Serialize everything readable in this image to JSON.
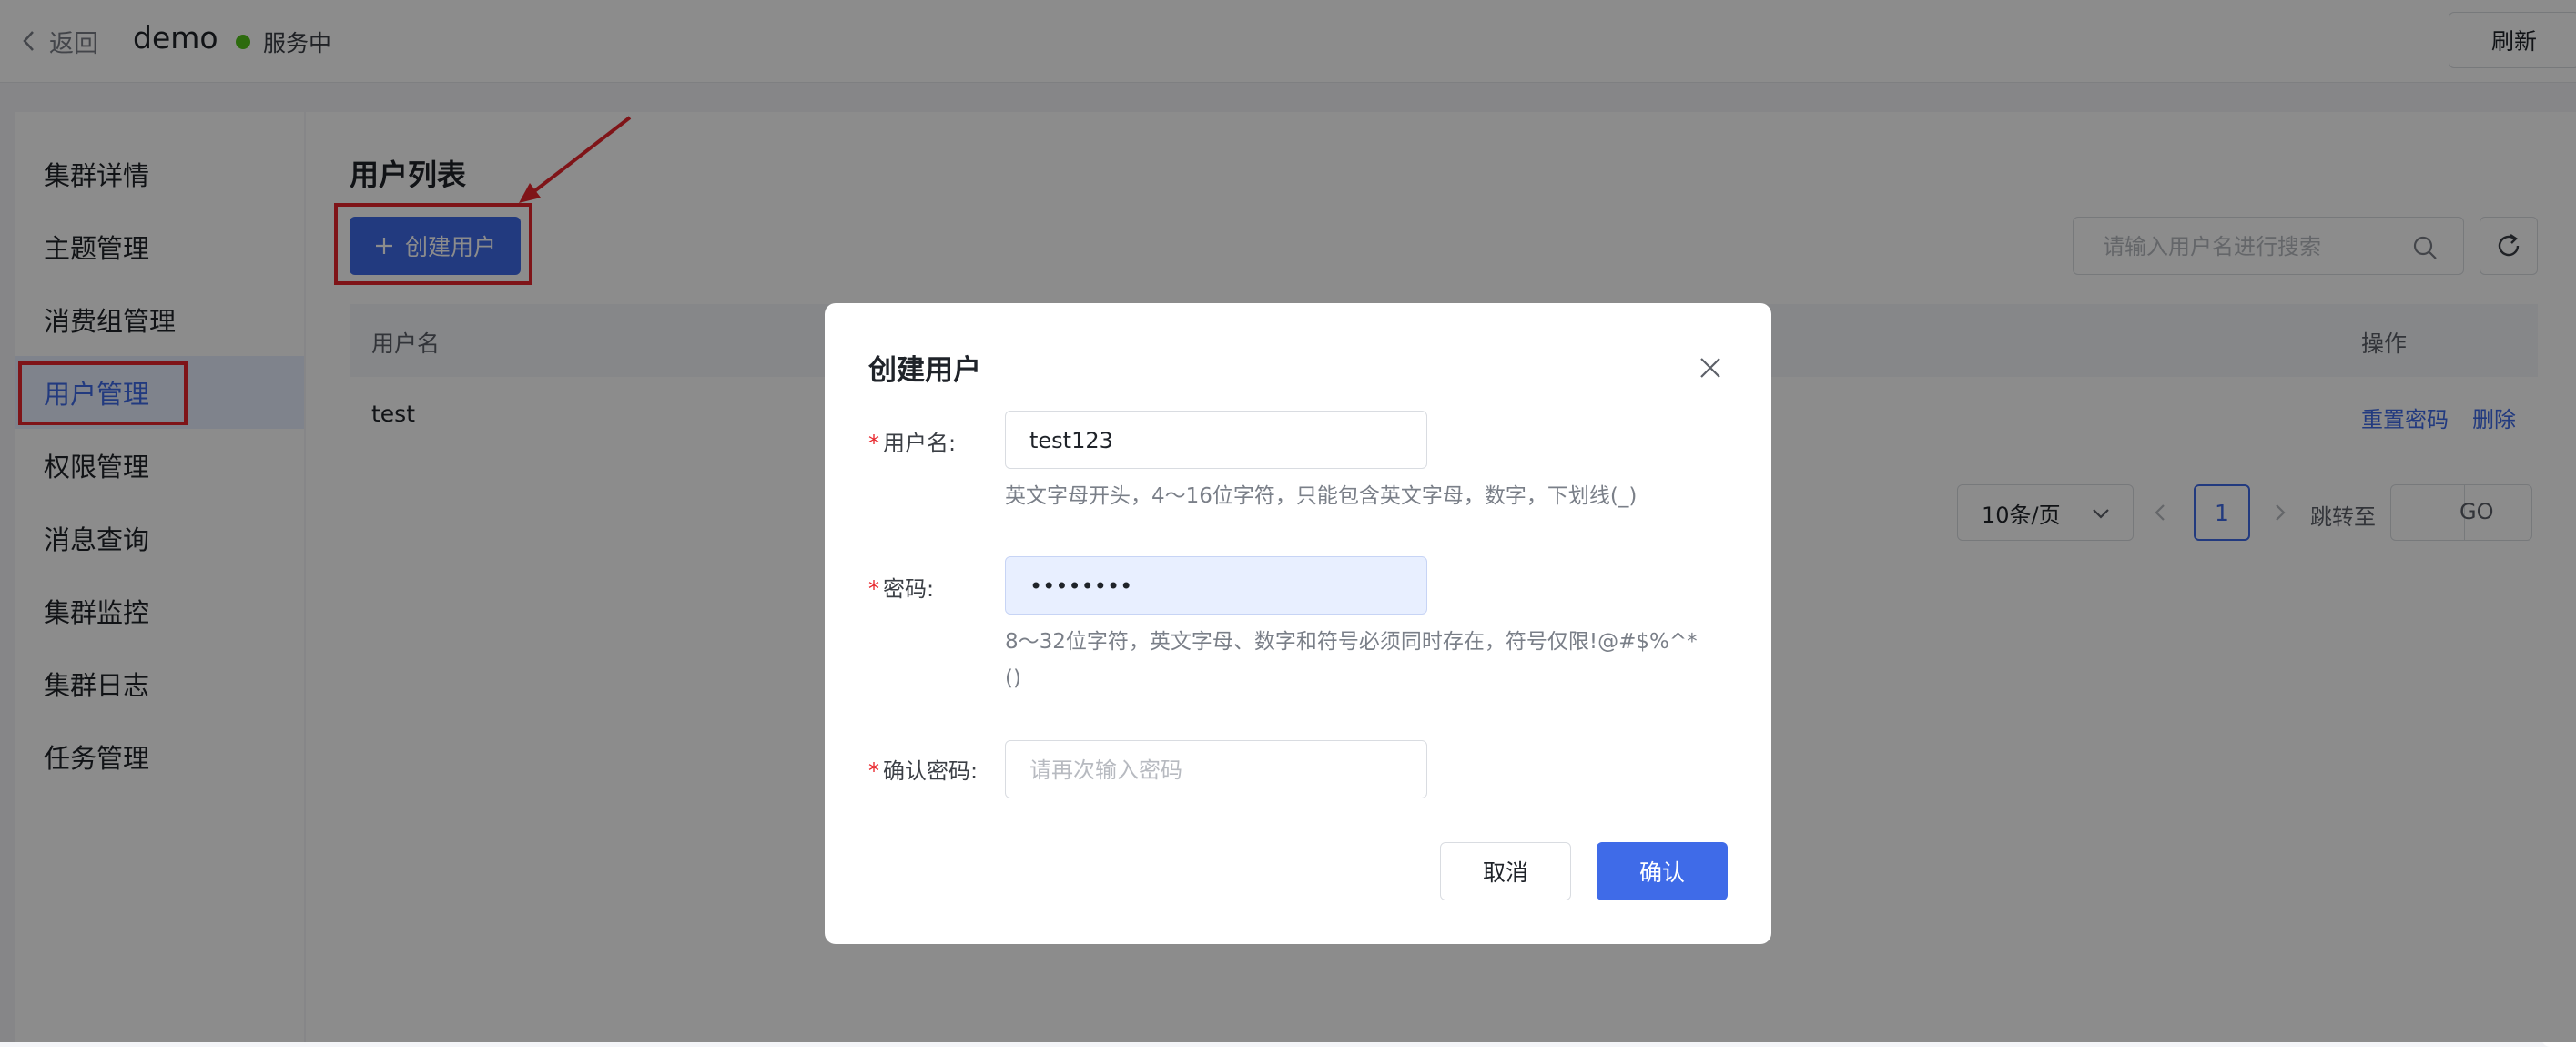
{
  "header": {
    "back_label": "返回",
    "app_name": "demo",
    "status_text": "服务中",
    "refresh_label": "刷新"
  },
  "sidebar": {
    "items": [
      {
        "label": "集群详情"
      },
      {
        "label": "主题管理"
      },
      {
        "label": "消费组管理"
      },
      {
        "label": "用户管理",
        "active": true
      },
      {
        "label": "权限管理"
      },
      {
        "label": "消息查询"
      },
      {
        "label": "集群监控"
      },
      {
        "label": "集群日志"
      },
      {
        "label": "任务管理"
      }
    ]
  },
  "main": {
    "title": "用户列表",
    "create_button": "创建用户",
    "search_placeholder": "请输入用户名进行搜索",
    "table": {
      "columns": [
        "用户名",
        "操作"
      ],
      "rows": [
        {
          "username": "test",
          "actions": [
            "重置密码",
            "删除"
          ]
        }
      ]
    },
    "pagination": {
      "page_size": "10条/页",
      "current_page": "1",
      "jump_label": "跳转至",
      "go_label": "GO"
    }
  },
  "dialog": {
    "title": "创建用户",
    "username": {
      "label": "用户名:",
      "value": "test123",
      "hint": "英文字母开头，4～16位字符，只能包含英文字母，数字，下划线(_)"
    },
    "password": {
      "label": "密码:",
      "value": "••••••••",
      "hint_line1": "8～32位字符，英文字母、数字和符号必须同时存在，符号仅限!@#$%^*",
      "hint_line2": "()"
    },
    "confirm_password": {
      "label": "确认密码:",
      "placeholder": "请再次输入密码"
    },
    "cancel_label": "取消",
    "confirm_label": "确认"
  },
  "colors": {
    "primary": "#3f6be8",
    "annotation_red": "#e8262c",
    "status_green": "#52c41a"
  }
}
